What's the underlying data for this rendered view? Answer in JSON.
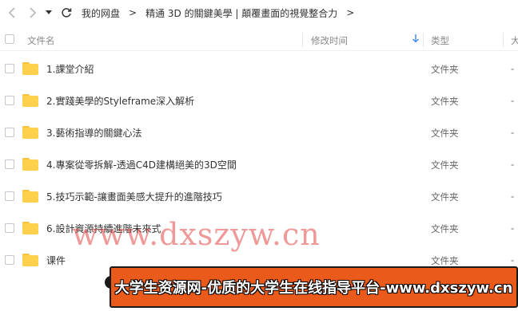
{
  "toolbar": {
    "back_icon": "arrow-left-icon",
    "forward_icon": "arrow-right-icon",
    "history_icon": "dropdown-caret-icon",
    "refresh_icon": "refresh-icon",
    "breadcrumb": [
      "我的网盘",
      "精通 3D 的關鍵美學 | 顛覆畫面的視覺整合力"
    ],
    "separator": ">"
  },
  "header": {
    "name": "文件名",
    "modified": "修改时间",
    "type": "类型",
    "size": "大",
    "sort_icon": "sort-down-arrow-icon",
    "sort_color": "#4a8ef7"
  },
  "files": [
    {
      "name": "1.課堂介紹",
      "type": "文件夹",
      "size": "-"
    },
    {
      "name": "2.實踐美學的Styleframe深入解析",
      "type": "文件夹",
      "size": "-"
    },
    {
      "name": "3.藝術指導的關鍵心法",
      "type": "文件夹",
      "size": "-"
    },
    {
      "name": "4.專案從零拆解-透過C4D建構絕美的3D空間",
      "type": "文件夹",
      "size": "-"
    },
    {
      "name": "5.技巧示範-讓畫面美感大提升的進階技巧",
      "type": "文件夹",
      "size": "-"
    },
    {
      "name": "6.設計資源持續進階未來式",
      "type": "文件夹",
      "size": "-"
    },
    {
      "name": "课件",
      "type": "文件夹",
      "size": "-"
    }
  ],
  "folder_color": "#ffd04b",
  "watermark": "www.dxszyw.cn",
  "banner": {
    "text": "大学生资源网-优质的大学生在线指导平台-www.dxszyw.cn",
    "color": "#ea5a1a"
  }
}
